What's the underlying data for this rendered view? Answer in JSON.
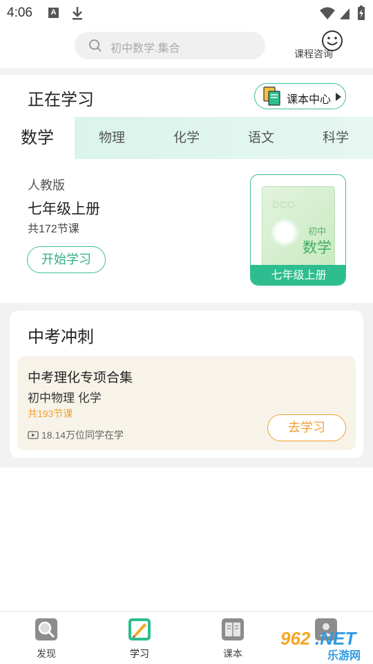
{
  "status_bar": {
    "time": "4:06",
    "a_badge": "A",
    "icons": [
      "a-notification-icon",
      "download-icon",
      "wifi-icon",
      "signal-icon",
      "battery-charging-icon"
    ]
  },
  "header": {
    "search_placeholder": "初中数学.集合",
    "consult_label": "课程咨询"
  },
  "learning": {
    "title": "正在学习",
    "textbook_center": "课本中心",
    "tabs": [
      {
        "label": "数学",
        "active": true
      },
      {
        "label": "物理",
        "active": false
      },
      {
        "label": "化学",
        "active": false
      },
      {
        "label": "语文",
        "active": false
      },
      {
        "label": "科学",
        "active": false
      }
    ],
    "edition": "人教版",
    "grade": "七年级上册",
    "lesson_count": "共172节课",
    "start_button": "开始学习",
    "book": {
      "logo": "DCO",
      "level": "初中",
      "subject": "数学",
      "band": "七年级上册"
    }
  },
  "sprint": {
    "title": "中考冲刺",
    "card": {
      "title": "中考理化专项合集",
      "subjects": "初中物理 化学",
      "lesson_count": "共193节课",
      "learners": "18.14万位同学在学",
      "button": "去学习"
    }
  },
  "bottom_nav": [
    {
      "label": "发现",
      "icon": "magnifier-icon",
      "active": false
    },
    {
      "label": "学习",
      "icon": "pencil-notebook-icon",
      "active": true
    },
    {
      "label": "课本",
      "icon": "book-icon",
      "active": false
    },
    {
      "label": "",
      "icon": "profile-icon",
      "active": false
    }
  ],
  "watermark": {
    "main": "962",
    "net": ".NET",
    "sub": "乐游网"
  },
  "colors": {
    "accent_green": "#2dbd8e",
    "accent_orange": "#f0a030",
    "tab_bg": "#d7f3ea"
  }
}
